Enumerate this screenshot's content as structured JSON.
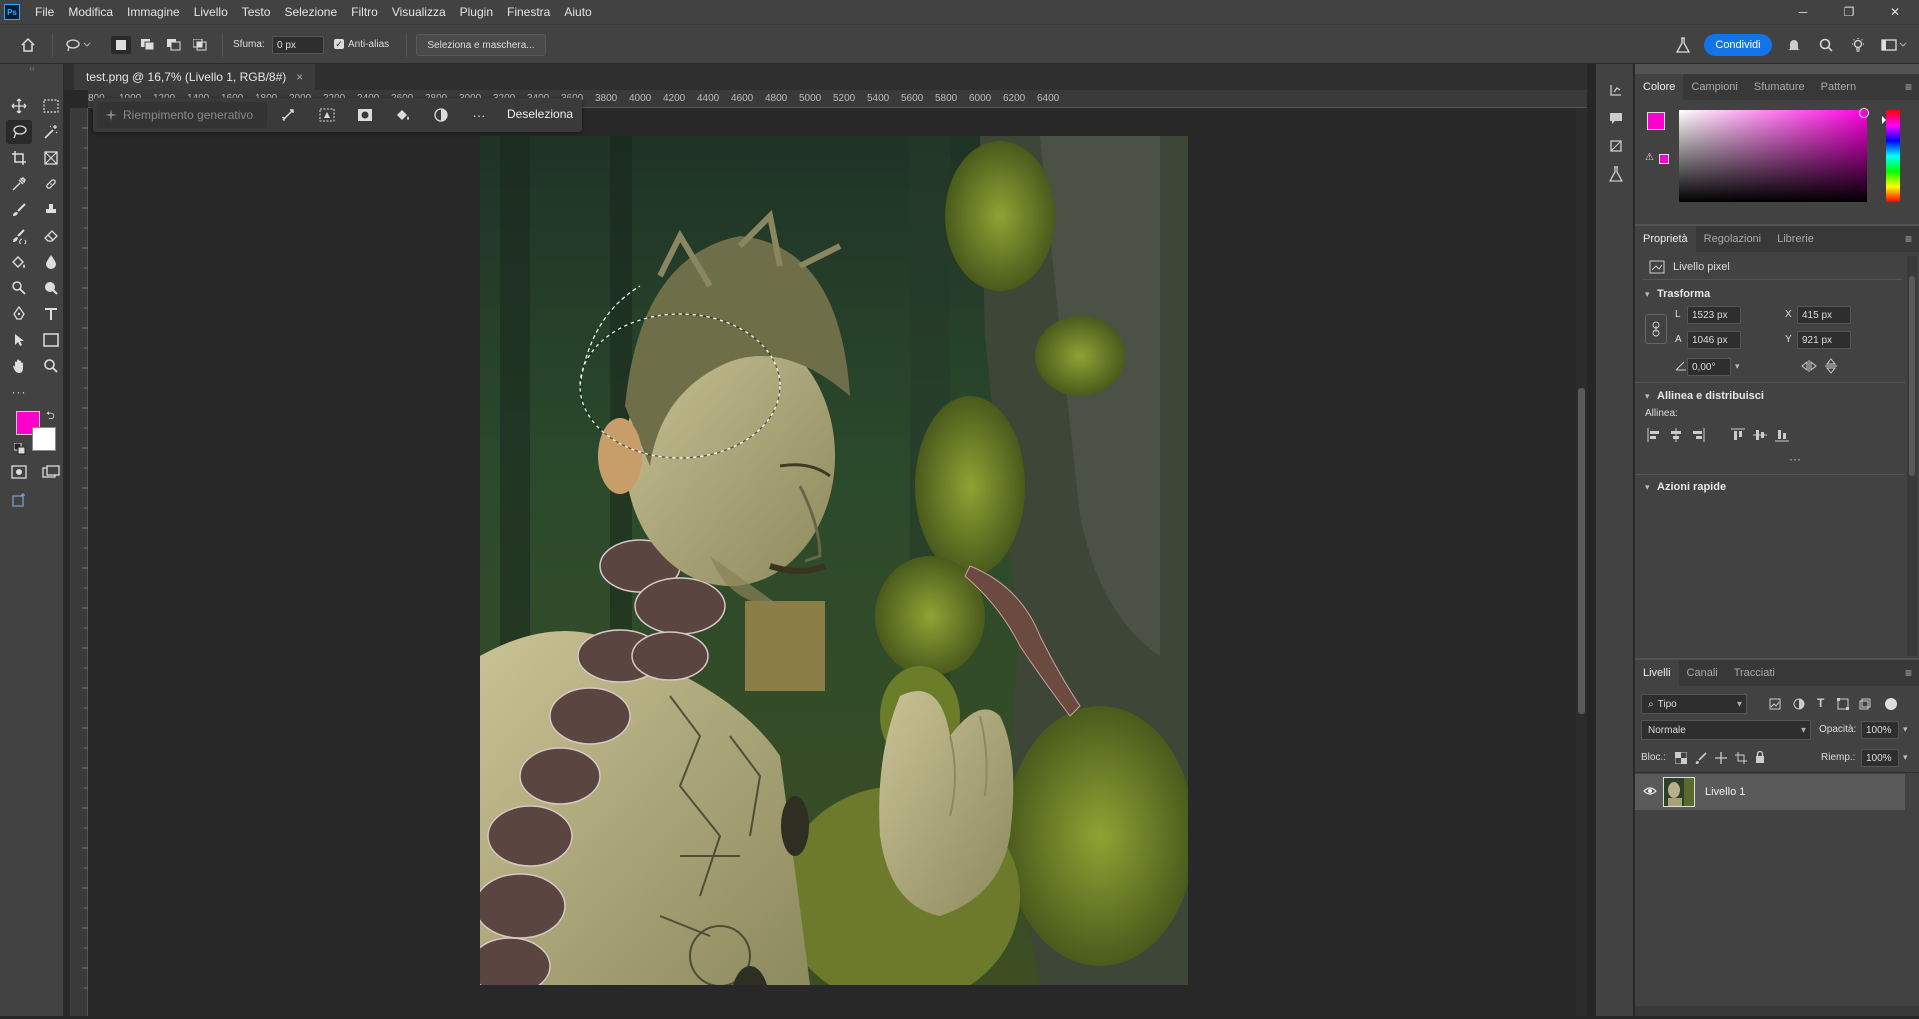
{
  "menubar": {
    "logo": "Ps",
    "items": [
      "File",
      "Modifica",
      "Immagine",
      "Livello",
      "Testo",
      "Selezione",
      "Filtro",
      "Visualizza",
      "Plugin",
      "Finestra",
      "Aiuto"
    ],
    "minimize": "─",
    "maximize": "❐",
    "close": "✕"
  },
  "optbar": {
    "feather_label": "Sfuma:",
    "feather_value": "0 px",
    "antialias_label": "Anti-alias",
    "antialias_checked": true,
    "select_mask_label": "Seleziona e maschera...",
    "share_label": "Condividi"
  },
  "tab": {
    "title": "test.png @ 16,7% (Livello 1, RGB/8#)",
    "close": "×"
  },
  "ruler": {
    "ticks": [
      "800",
      "1000",
      "1200",
      "1400",
      "1600",
      "1800",
      "2000",
      "2200",
      "2400",
      "2600",
      "2800",
      "3000",
      "3200",
      "3400",
      "3600",
      "3800",
      "4000",
      "4200",
      "4400",
      "4600",
      "4800",
      "5000",
      "5200",
      "5400",
      "5600",
      "5800",
      "6000",
      "6200",
      "6400"
    ]
  },
  "contextbar": {
    "generative_fill": "Riempimento generativo",
    "more": "···",
    "deselect": "Deseleziona"
  },
  "colors": {
    "foreground": "#ff00cc",
    "background": "#ffffff",
    "accent": "#1473e6"
  },
  "color_panel": {
    "tabs": [
      "Colore",
      "Campioni",
      "Sfumature",
      "Pattern"
    ],
    "active": "Colore"
  },
  "properties_panel": {
    "tabs": [
      "Proprietà",
      "Regolazioni",
      "Librerie"
    ],
    "layer_type": "Livello pixel",
    "transform_title": "Trasforma",
    "w_label": "L",
    "w_value": "1523 px",
    "h_label": "A",
    "h_value": "1046 px",
    "x_label": "X",
    "x_value": "415 px",
    "y_label": "Y",
    "y_value": "921 px",
    "angle_value": "0,00°",
    "align_title": "Allinea e distribuisci",
    "align_label": "Allinea:",
    "more": "···",
    "quick_actions_title": "Azioni rapide"
  },
  "layers_panel": {
    "tabs": [
      "Livelli",
      "Canali",
      "Tracciati"
    ],
    "filter_kind": "Tipo",
    "blend_mode": "Normale",
    "opacity_label": "Opacità:",
    "opacity_value": "100%",
    "lock_label": "Bloc.:",
    "fill_label": "Riemp.:",
    "fill_value": "100%",
    "layers": [
      {
        "name": "Livello 1",
        "visible": true,
        "selected": true
      }
    ]
  }
}
